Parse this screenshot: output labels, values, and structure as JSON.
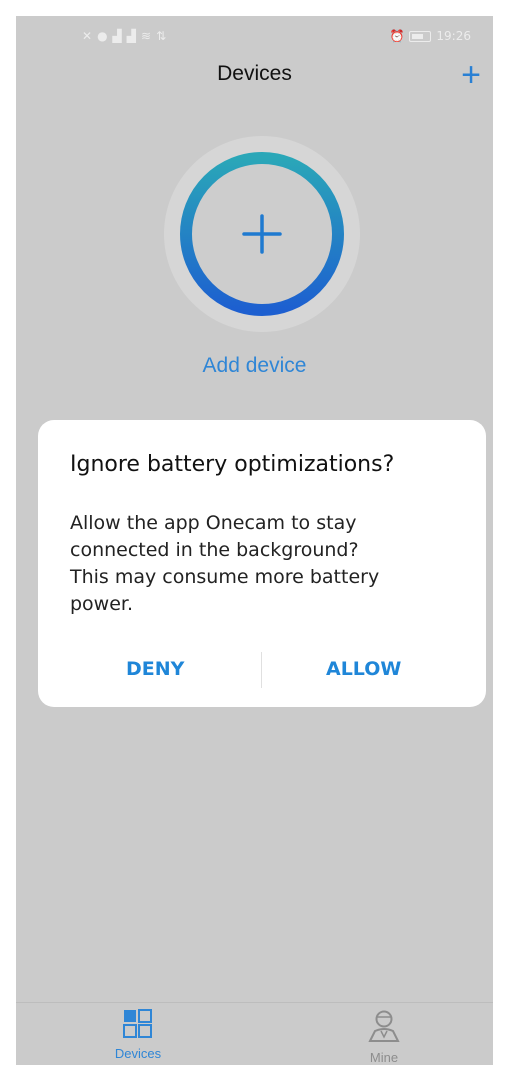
{
  "status_bar": {
    "left_icons": [
      "x-icon",
      "dot-icon",
      "signal-icon",
      "signal-icon",
      "wifi-icon",
      "data-icon"
    ],
    "time": "19:26"
  },
  "header": {
    "title": "Devices",
    "add_icon": "plus-icon"
  },
  "main": {
    "add_device_label": "Add device"
  },
  "dialog": {
    "title": "Ignore battery optimizations?",
    "body_lines": [
      "Allow the app Onecam to stay",
      "connected in the background?",
      "This may consume more battery",
      "power."
    ],
    "deny_label": "DENY",
    "allow_label": "ALLOW"
  },
  "tabbar": {
    "tabs": [
      {
        "label": "Devices",
        "icon": "grid-icon",
        "active": true
      },
      {
        "label": "Mine",
        "icon": "person-icon",
        "active": false
      }
    ]
  },
  "colors": {
    "accent": "#2f86d6",
    "ring_start": "#2aa7b8",
    "ring_end": "#1d5fd0",
    "overlay": "#cbcbcb"
  }
}
